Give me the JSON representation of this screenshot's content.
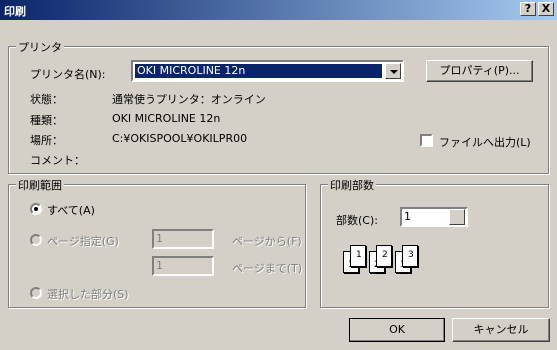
{
  "window": {
    "title": "印刷",
    "help_btn": "?",
    "close_btn": "X"
  },
  "printer": {
    "group_label": "プリンタ",
    "name_label": "プリンタ名(N):",
    "name_value": "OKI MICROLINE 12n",
    "properties_button": "プロパティ(P)...",
    "status_label": "状態：",
    "status_value": "通常使うプリンタ：オンライン",
    "type_label": "種類：",
    "type_value": "OKI MICROLINE 12n",
    "location_label": "場所：",
    "location_value": "C:¥OKISPOOL¥OKILPR00",
    "comment_label": "コメント：",
    "print_to_file": "ファイルへ出力(L)"
  },
  "range": {
    "group_label": "印刷範囲",
    "all": "すべて(A)",
    "pages": "ページ指定(G)",
    "from_value": "1",
    "from_label": "ページから(F)",
    "to_value": "1",
    "to_label": "ページまで(T)",
    "selection": "選択した部分(S)"
  },
  "copies": {
    "group_label": "印刷部数",
    "count_label": "部数(C):",
    "count_value": "1",
    "collate_pages": [
      "1",
      "1",
      "2",
      "2",
      "3",
      "3"
    ]
  },
  "buttons": {
    "ok": "OK",
    "cancel": "キャンセル"
  }
}
